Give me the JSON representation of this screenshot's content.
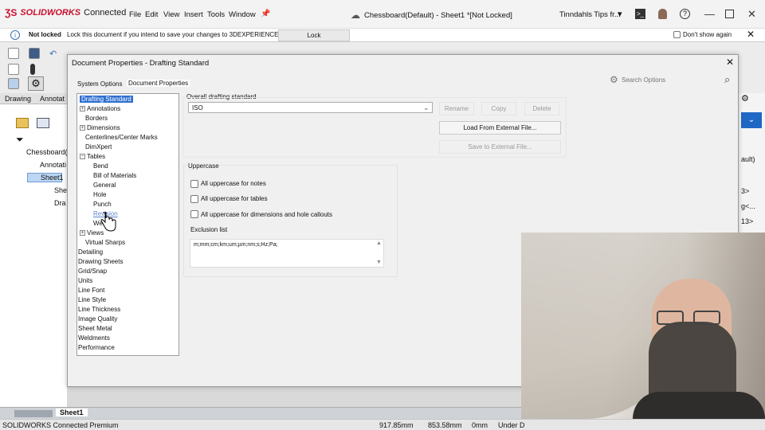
{
  "app": {
    "logo": "SOLIDWORKS",
    "logo_suffix": "Connected",
    "menu": [
      "File",
      "Edit",
      "View",
      "Insert",
      "Tools",
      "Window"
    ],
    "doc_title": "Chessboard(Default) - Sheet1 *[Not Locked]",
    "user": "Tinndahls Tips fr..."
  },
  "notification": {
    "status": "Not locked",
    "message": "Lock this document if you intend to save your changes to 3DEXPERIENCE.",
    "lock_button": "Lock",
    "dont_show": "Don't show again"
  },
  "left_tabs": [
    "Drawing",
    "Annotat"
  ],
  "feature_tree": [
    "Chessboard(",
    "Annotati",
    "Sheet1",
    "She",
    "Dra"
  ],
  "right_panel": [
    "ault)",
    "3>",
    "g<...",
    "13>"
  ],
  "bottom": {
    "sheet_tab": "Sheet1"
  },
  "status": {
    "app": "SOLIDWORKS Connected Premium",
    "x": "917.85mm",
    "y": "853.58mm",
    "z": "0mm",
    "state": "Under D"
  },
  "dialog": {
    "title": "Document Properties - Drafting Standard",
    "tabs": [
      "System Options",
      "Document Properties"
    ],
    "search_placeholder": "Search Options",
    "tree": [
      {
        "label": "Drafting Standard",
        "level": 0,
        "exp": "",
        "selected": true
      },
      {
        "label": "Annotations",
        "level": 0,
        "exp": "+"
      },
      {
        "label": "Borders",
        "level": 1,
        "exp": ""
      },
      {
        "label": "Dimensions",
        "level": 0,
        "exp": "+"
      },
      {
        "label": "Centerlines/Center Marks",
        "level": 1,
        "exp": ""
      },
      {
        "label": "DimXpert",
        "level": 1,
        "exp": ""
      },
      {
        "label": "Tables",
        "level": 0,
        "exp": "-"
      },
      {
        "label": "Bend",
        "level": 2,
        "exp": ""
      },
      {
        "label": "Bill of Materials",
        "level": 2,
        "exp": ""
      },
      {
        "label": "General",
        "level": 2,
        "exp": ""
      },
      {
        "label": "Hole",
        "level": 2,
        "exp": ""
      },
      {
        "label": "Punch",
        "level": 2,
        "exp": ""
      },
      {
        "label": "Revision",
        "level": 2,
        "exp": "",
        "hover": true
      },
      {
        "label": "Weld",
        "level": 2,
        "exp": ""
      },
      {
        "label": "Views",
        "level": 0,
        "exp": "+"
      },
      {
        "label": "Virtual Sharps",
        "level": 1,
        "exp": ""
      },
      {
        "label": "Detailing",
        "level": -1,
        "exp": ""
      },
      {
        "label": "Drawing Sheets",
        "level": -1,
        "exp": ""
      },
      {
        "label": "Grid/Snap",
        "level": -1,
        "exp": ""
      },
      {
        "label": "Units",
        "level": -1,
        "exp": ""
      },
      {
        "label": "Line Font",
        "level": -1,
        "exp": ""
      },
      {
        "label": "Line Style",
        "level": -1,
        "exp": ""
      },
      {
        "label": "Line Thickness",
        "level": -1,
        "exp": ""
      },
      {
        "label": "Image Quality",
        "level": -1,
        "exp": ""
      },
      {
        "label": "Sheet Metal",
        "level": -1,
        "exp": ""
      },
      {
        "label": "Weldments",
        "level": -1,
        "exp": ""
      },
      {
        "label": "Performance",
        "level": -1,
        "exp": ""
      }
    ],
    "standard_label": "Overall drafting standard",
    "standard_value": "ISO",
    "buttons": {
      "rename": "Rename",
      "copy": "Copy",
      "delete": "Delete",
      "load": "Load From External File...",
      "save": "Save to External File..."
    },
    "uppercase": {
      "title": "Uppercase",
      "notes": "All uppercase for notes",
      "tables": "All uppercase for tables",
      "dims": "All uppercase for dimensions and hole callouts"
    },
    "exclusion": {
      "label": "Exclusion list",
      "value": "m;mm;cm;km;um;µm;nm;s;Hz;Pa;"
    }
  },
  "colors": {
    "accent": "#2f6fd0",
    "brand": "#c8102e"
  }
}
